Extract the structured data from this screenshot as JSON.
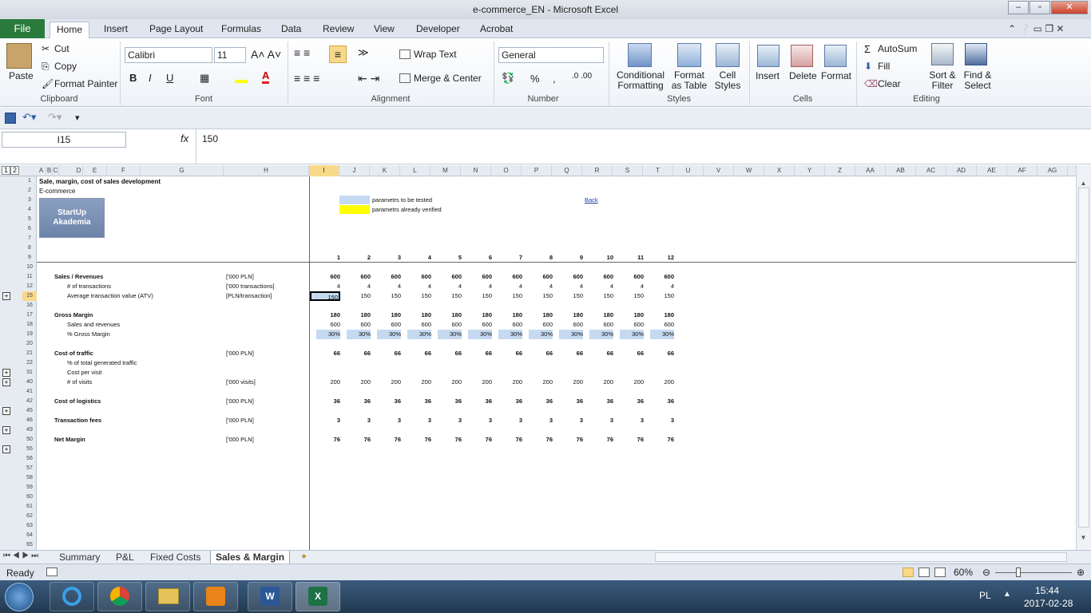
{
  "window": {
    "title": "e-commerce_EN  -  Microsoft Excel",
    "min": "–",
    "max": "▫",
    "close": "✕"
  },
  "ribbon_tabs": [
    "File",
    "Home",
    "Insert",
    "Page Layout",
    "Formulas",
    "Data",
    "Review",
    "View",
    "Developer",
    "Acrobat"
  ],
  "active_tab": "Home",
  "clipboard": {
    "paste": "Paste",
    "cut": "Cut",
    "copy": "Copy",
    "format_painter": "Format Painter",
    "label": "Clipboard"
  },
  "font": {
    "name": "Calibri",
    "size": "11",
    "label": "Font",
    "bold": "B",
    "italic": "I",
    "underline": "U"
  },
  "alignment": {
    "wrap": "Wrap Text",
    "merge": "Merge & Center",
    "label": "Alignment"
  },
  "number": {
    "format": "General",
    "percent": "%",
    "comma": ",",
    "label": "Number"
  },
  "styles": {
    "conditional": "Conditional",
    "conditional2": "Formatting",
    "format_table": "Format",
    "format_table2": "as Table",
    "cell_styles": "Cell",
    "cell_styles2": "Styles",
    "label": "Styles"
  },
  "cells": {
    "insert": "Insert",
    "delete": "Delete",
    "format": "Format",
    "label": "Cells"
  },
  "editing": {
    "autosum": "AutoSum",
    "fill": "Fill",
    "clear": "Clear",
    "sort": "Sort &",
    "sort2": "Filter",
    "find": "Find &",
    "find2": "Select",
    "label": "Editing"
  },
  "formula_bar": {
    "name_box": "I15",
    "fx": "fx",
    "value": "150"
  },
  "columns": [
    "A",
    "B",
    "C",
    "D",
    "E",
    "F",
    "G",
    "H",
    "I",
    "J",
    "K",
    "L",
    "M",
    "N",
    "O",
    "P",
    "Q",
    "R",
    "S",
    "T",
    "U",
    "V",
    "W",
    "X",
    "Y",
    "Z",
    "AA",
    "AB",
    "AC",
    "AD",
    "AE",
    "AF",
    "AG"
  ],
  "outline_levels": [
    "1",
    "2"
  ],
  "sheet": {
    "title": "Sale, margin, cost of sales development",
    "subtitle": "E-commerce",
    "logo_text": "StartUp Akademia",
    "legend_tested": "parametrs to be tested",
    "legend_verified": "parametrs already verified",
    "back_link": "Back",
    "months": [
      "1",
      "2",
      "3",
      "4",
      "5",
      "6",
      "7",
      "8",
      "9",
      "10",
      "11",
      "12"
    ],
    "rows": [
      {
        "n": "1"
      },
      {
        "n": "2"
      },
      {
        "n": "3"
      },
      {
        "n": "4"
      },
      {
        "n": "5"
      },
      {
        "n": "6"
      },
      {
        "n": "7"
      },
      {
        "n": "8"
      },
      {
        "n": "9"
      },
      {
        "n": "10"
      },
      {
        "n": "11",
        "label": "Sales / Revenues",
        "unit": "['000 PLN]",
        "vals": [
          "600",
          "600",
          "600",
          "600",
          "600",
          "600",
          "600",
          "600",
          "600",
          "600",
          "600",
          "600"
        ],
        "bold": true,
        "indent": 0
      },
      {
        "n": "12",
        "label": "# of transactions",
        "unit": "['000 transactions]",
        "vals": [
          "4",
          "4",
          "4",
          "4",
          "4",
          "4",
          "4",
          "4",
          "4",
          "4",
          "4",
          "4"
        ],
        "indent": 1
      },
      {
        "n": "15",
        "label": "Average transaction value (ATV)",
        "unit": "[PLN/transaction]",
        "vals": [
          "150",
          "150",
          "150",
          "150",
          "150",
          "150",
          "150",
          "150",
          "150",
          "150",
          "150",
          "150"
        ],
        "indent": 1,
        "plus": true,
        "sel": true
      },
      {
        "n": "16"
      },
      {
        "n": "17",
        "label": "Gross Margin",
        "vals": [
          "180",
          "180",
          "180",
          "180",
          "180",
          "180",
          "180",
          "180",
          "180",
          "180",
          "180",
          "180"
        ],
        "bold": true,
        "indent": 0
      },
      {
        "n": "18",
        "label": "Sales and revenues",
        "vals": [
          "600",
          "600",
          "600",
          "600",
          "600",
          "600",
          "600",
          "600",
          "600",
          "600",
          "600",
          "600"
        ],
        "indent": 1
      },
      {
        "n": "19",
        "label": "% Gross Margin",
        "vals": [
          "30%",
          "30%",
          "30%",
          "30%",
          "30%",
          "30%",
          "30%",
          "30%",
          "30%",
          "30%",
          "30%",
          "30%"
        ],
        "indent": 1,
        "hl": true
      },
      {
        "n": "20"
      },
      {
        "n": "21",
        "label": "Cost of traffic",
        "unit": "['000 PLN]",
        "vals": [
          "66",
          "66",
          "66",
          "66",
          "66",
          "66",
          "66",
          "66",
          "66",
          "66",
          "66",
          "66"
        ],
        "bold": true,
        "indent": 0
      },
      {
        "n": "22",
        "label": "% of total generated traffic",
        "indent": 1
      },
      {
        "n": "31",
        "label": "Cost per visit",
        "indent": 1,
        "plus": true
      },
      {
        "n": "40",
        "label": "# of visits",
        "unit": "['000 visits]",
        "vals": [
          "200",
          "200",
          "200",
          "200",
          "200",
          "200",
          "200",
          "200",
          "200",
          "200",
          "200",
          "200"
        ],
        "indent": 1,
        "plus": true
      },
      {
        "n": "41"
      },
      {
        "n": "42",
        "label": "Cost of logistics",
        "unit": "['000 PLN]",
        "vals": [
          "36",
          "36",
          "36",
          "36",
          "36",
          "36",
          "36",
          "36",
          "36",
          "36",
          "36",
          "36"
        ],
        "bold": true,
        "indent": 0
      },
      {
        "n": "45",
        "plus": true
      },
      {
        "n": "46",
        "label": "Transaction fees",
        "unit": "['000 PLN]",
        "vals": [
          "3",
          "3",
          "3",
          "3",
          "3",
          "3",
          "3",
          "3",
          "3",
          "3",
          "3",
          "3"
        ],
        "bold": true,
        "indent": 0
      },
      {
        "n": "49",
        "plus": true
      },
      {
        "n": "50",
        "label": "Net Margin",
        "unit": "['000 PLN]",
        "vals": [
          "76",
          "76",
          "76",
          "76",
          "76",
          "76",
          "76",
          "76",
          "76",
          "76",
          "76",
          "76"
        ],
        "bold": true,
        "indent": 0
      },
      {
        "n": "55",
        "plus": true
      },
      {
        "n": "56"
      },
      {
        "n": "57"
      },
      {
        "n": "58"
      },
      {
        "n": "59"
      },
      {
        "n": "60"
      },
      {
        "n": "61"
      },
      {
        "n": "62"
      },
      {
        "n": "63"
      },
      {
        "n": "64"
      },
      {
        "n": "65"
      }
    ]
  },
  "sheet_tabs": [
    "Summary",
    "P&L",
    "Fixed Costs",
    "Sales & Margin"
  ],
  "active_sheet": "Sales & Margin",
  "status": {
    "ready": "Ready",
    "zoom": "60%"
  },
  "taskbar": {
    "lang": "PL",
    "time": "15:44",
    "date": "2017-02-28"
  },
  "colors": {
    "tested": "#c5d9f1",
    "verified": "#ffff00",
    "excel_green": "#2a7a3b",
    "selection": "#f8d98a"
  }
}
